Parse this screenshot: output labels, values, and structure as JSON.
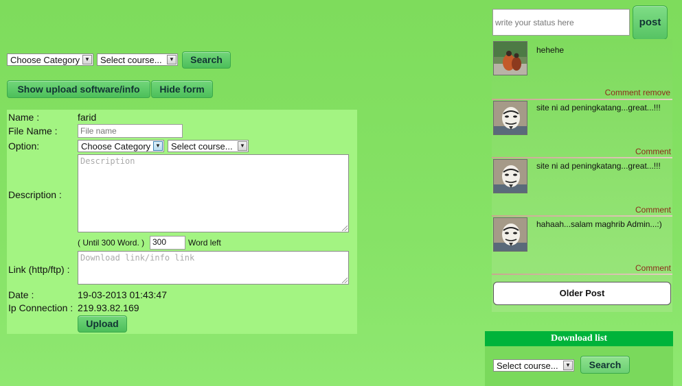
{
  "search_bar": {
    "category_value": "Choose Category",
    "course_value": "Select course...",
    "search_label": "Search"
  },
  "actions": {
    "show_label": "Show upload software/info",
    "hide_label": "Hide form"
  },
  "form": {
    "name_label": "Name :",
    "name_value": "farid",
    "filename_label": "File Name :",
    "filename_placeholder": "File name",
    "option_label": "Option:",
    "option_category": "Choose Category",
    "option_course": "Select course...",
    "description_label": "Description :",
    "description_placeholder": "Description",
    "word_limit_prefix": "( Until 300 Word. )",
    "word_count": "300",
    "word_left_suffix": "Word left",
    "link_label": "Link (http/ftp) :",
    "link_placeholder": "Download link/info link",
    "date_label": "Date :",
    "date_value": "19-03-2013 01:43:47",
    "ip_label": "Ip Connection :",
    "ip_value": "219.93.82.169",
    "upload_label": "Upload"
  },
  "status": {
    "placeholder": "write your status here",
    "post_label": "post"
  },
  "feed": {
    "posts": [
      {
        "text": "hehehe",
        "comment_label": "Comment",
        "remove_label": "remove"
      },
      {
        "text": "site ni ad peningkatang...great...!!!",
        "comment_label": "Comment"
      },
      {
        "text": "site ni ad peningkatang...great...!!!",
        "comment_label": "Comment"
      },
      {
        "text": "hahaah...salam maghrib Admin...:)",
        "comment_label": "Comment"
      }
    ],
    "older_label": "Older Post"
  },
  "download": {
    "title": "Download list",
    "course_value": "Select course...",
    "search_label": "Search"
  }
}
